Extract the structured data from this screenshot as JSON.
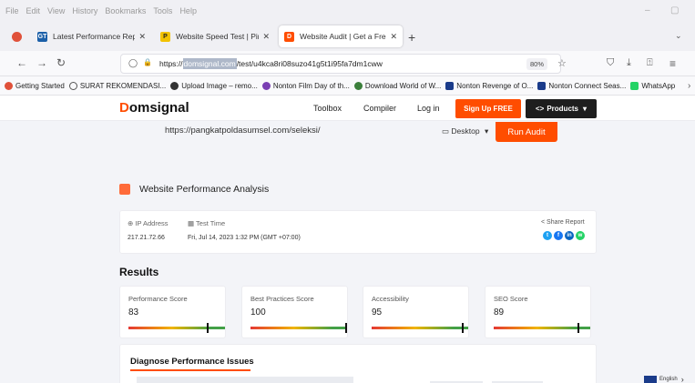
{
  "menubar": {
    "items": [
      "File",
      "Edit",
      "View",
      "History",
      "Bookmarks",
      "Tools",
      "Help"
    ],
    "minimize_glyph": "–",
    "restore_glyph": "▢"
  },
  "tabs": [
    {
      "label": "Latest Performance Report for",
      "icon": "gtmetrix-icon",
      "fav_text": "GT",
      "color": "#1b5fa8",
      "active": false
    },
    {
      "label": "Website Speed Test | Pingdom",
      "icon": "pingdom-icon",
      "fav_text": "P",
      "color": "#f2c200",
      "active": false
    },
    {
      "label": "Website Audit | Get a Free Web",
      "icon": "domsignal-icon",
      "fav_text": "D",
      "color": "#ff4d00",
      "active": true
    }
  ],
  "tab_close_glyph": "✕",
  "newtab_glyph": "+",
  "dropdown_glyph": "⌄",
  "navbar": {
    "back_glyph": "←",
    "forward_glyph": "→",
    "reload_glyph": "↻",
    "shield_glyph": "◯",
    "lock_glyph": "🔒",
    "url_prefix": "https://",
    "url_highlight": "domsignal.com",
    "url_suffix": "/test/u4kca8ri08suzo41g5t1i95fa7dm1cww",
    "zoom": "80%",
    "star_glyph": "☆",
    "pocket_glyph": "⛉",
    "download_glyph": "⤓",
    "share_glyph": "⍐",
    "menu_glyph": "≡"
  },
  "bookmarks": [
    {
      "label": "Getting Started",
      "color": "#e0513a"
    },
    {
      "label": "SURAT REKOMENDASI...",
      "color": "#555555"
    },
    {
      "label": "Upload Image – remo...",
      "color": "#333333"
    },
    {
      "label": "Nonton Film Day of th...",
      "color": "#7a3fb3"
    },
    {
      "label": "Download World of W...",
      "color": "#3b7f3b"
    },
    {
      "label": "Nonton Revenge of O...",
      "color": "#1a3b8a"
    },
    {
      "label": "Nonton Connect Seas...",
      "color": "#1a3b8a"
    },
    {
      "label": "WhatsApp",
      "color": "#25d366"
    }
  ],
  "bookmarks_overflow_glyph": "›",
  "site": {
    "logo_initial": "D",
    "logo_rest": "omsignal",
    "nav": [
      "Toolbox",
      "Compiler",
      "Log in"
    ],
    "signup": "Sign Up FREE",
    "products": "Products",
    "products_icon_glyph": "<>",
    "caret_glyph": "▾"
  },
  "audit": {
    "url": "https://pangkatpoldasumsel.com/seleksi/",
    "device": "Desktop",
    "device_icon_glyph": "▭",
    "run": "Run Audit"
  },
  "analysis": {
    "title": "Website Performance Analysis",
    "ip_label": "IP Address",
    "ip_icon_glyph": "⊕",
    "ip_value": "217.21.72.66",
    "time_label": "Test Time",
    "time_icon_glyph": "▦",
    "time_value": "Fri, Jul 14, 2023 1:32 PM (GMT +07:00)",
    "share_label": "Share Report",
    "share_icon_glyph": "<",
    "share_icons": [
      {
        "name": "twitter-icon",
        "color": "#1da1f2",
        "glyph": "t"
      },
      {
        "name": "facebook-icon",
        "color": "#1877f2",
        "glyph": "f"
      },
      {
        "name": "linkedin-icon",
        "color": "#0a66c2",
        "glyph": "in"
      },
      {
        "name": "whatsapp-icon",
        "color": "#25d366",
        "glyph": "w"
      }
    ]
  },
  "results": {
    "title": "Results",
    "scores": [
      {
        "label": "Performance Score",
        "value": "83",
        "level": 83
      },
      {
        "label": "Best Practices Score",
        "value": "100",
        "level": 100
      },
      {
        "label": "Accessibility",
        "value": "95",
        "level": 95
      },
      {
        "label": "SEO Score",
        "value": "89",
        "level": 89
      }
    ]
  },
  "diagnose": {
    "title": "Diagnose Performance Issues"
  },
  "language": {
    "label": "English",
    "chevron_glyph": "›"
  }
}
